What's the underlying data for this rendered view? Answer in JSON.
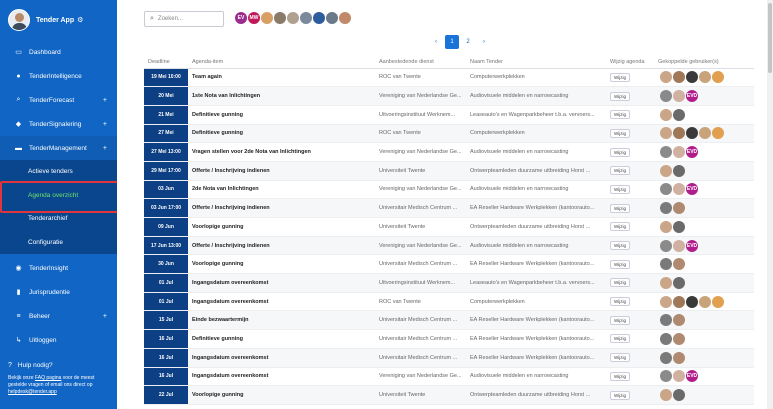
{
  "app": {
    "title": "Tender App"
  },
  "sidebar": {
    "items": [
      {
        "label": "Dashboard",
        "icon": "monitor-icon",
        "glyph": "▭",
        "plus": ""
      },
      {
        "label": "TenderIntelligence",
        "icon": "bulb-icon",
        "glyph": "●",
        "plus": ""
      },
      {
        "label": "TenderForecast",
        "icon": "search-icon",
        "glyph": "⌕",
        "plus": "+"
      },
      {
        "label": "TenderSignalering",
        "icon": "bell-icon",
        "glyph": "◆",
        "plus": "+"
      },
      {
        "label": "TenderManagement",
        "icon": "folder-icon",
        "glyph": "▬",
        "plus": "+"
      }
    ],
    "sub_items": [
      "Actieve tenders",
      "Agenda overzicht",
      "Tenderarchief",
      "Configuratie"
    ],
    "items2": [
      {
        "label": "TenderInsight",
        "icon": "eye-icon",
        "glyph": "◉",
        "plus": ""
      },
      {
        "label": "Jurisprudentie",
        "icon": "book-icon",
        "glyph": "▮",
        "plus": ""
      },
      {
        "label": "Beheer",
        "icon": "sliders-icon",
        "glyph": "≡",
        "plus": "+"
      },
      {
        "label": "Uitloggen",
        "icon": "logout-icon",
        "glyph": "↳",
        "plus": ""
      }
    ],
    "help": {
      "title": "Hulp nodig?",
      "text1": "Bekijk onze",
      "faq": "FAQ pagina",
      "text2": "voor de meest gestelde vragen of email ons direct op",
      "email": "helpdesk@tender.app"
    }
  },
  "search": {
    "placeholder": "Zoeken..."
  },
  "filter_users": [
    {
      "initials": "EV",
      "color": "#9b2d8e"
    },
    {
      "initials": "MW",
      "color": "#c2185b"
    },
    {
      "initials": "",
      "color": "#d9a066"
    },
    {
      "initials": "",
      "color": "#8a7a6a"
    },
    {
      "initials": "",
      "color": "#b0a090"
    },
    {
      "initials": "",
      "color": "#7a8a9a"
    },
    {
      "initials": "",
      "color": "#2e5d9e"
    },
    {
      "initials": "",
      "color": "#6a7a8a"
    },
    {
      "initials": "",
      "color": "#c08a6a"
    }
  ],
  "pagination": {
    "prev": "‹",
    "pages": [
      "1",
      "2"
    ],
    "next": "›"
  },
  "table": {
    "headers": [
      "Deadline",
      "Agenda-item",
      "Aanbestedende dienst",
      "Naam Tender",
      "Wijzig agenda",
      "Gekoppelde gebruiker(s)"
    ],
    "edit_label": "Wijzig",
    "rows": [
      {
        "deadline": "19 Mei 10:00",
        "item": "Team again",
        "dienst": "ROC van Twente",
        "tender": "Computerwerkplekken",
        "users": [
          "#caa588",
          "#a07858",
          "#3a3a3a",
          "#c9a37a",
          "#e0a050"
        ]
      },
      {
        "deadline": "20 Mei",
        "item": "1ste Nota van Inlichtingen",
        "dienst": "Vereniging van Nederlandse Ge...",
        "tender": "Audiovisuele middelen en narrowcasting",
        "users": [
          "#8a8a8a",
          "#d0b0a0",
          "EVD"
        ]
      },
      {
        "deadline": "21 Mei",
        "item": "Definitieve gunning",
        "dienst": "Uitvoeringsinstituut Werknem...",
        "tender": "Leaseauto's en Wagenparkbeheer t.b.a. vervoers...",
        "users": [
          "#caa588",
          "#6a6a6a"
        ]
      },
      {
        "deadline": "27 Mei",
        "item": "Definitieve gunning",
        "dienst": "ROC van Twente",
        "tender": "Computerwerkplekken",
        "users": [
          "#caa588",
          "#a07858",
          "#3a3a3a",
          "#c9a37a",
          "#e0a050"
        ]
      },
      {
        "deadline": "27 Mei 13:00",
        "item": "Vragen stellen voor 2de Nota van Inlichtingen",
        "dienst": "Vereniging van Nederlandse Ge...",
        "tender": "Audiovisuele middelen en narrowcasting",
        "users": [
          "#8a8a8a",
          "#d0b0a0",
          "EVD"
        ]
      },
      {
        "deadline": "29 Mei 17:00",
        "item": "Offerte / Inschrijving indienen",
        "dienst": "Universiteit Twente",
        "tender": "Ontwerpteamleden duurzame uitbreiding Horst ...",
        "users": [
          "#caa588",
          "#6a6a6a"
        ]
      },
      {
        "deadline": "03 Jun",
        "item": "2de Nota van Inlichtingen",
        "dienst": "Vereniging van Nederlandse Ge...",
        "tender": "Audiovisuele middelen en narrowcasting",
        "users": [
          "#8a8a8a",
          "#d0b0a0",
          "EVD"
        ]
      },
      {
        "deadline": "03 Jun 17:00",
        "item": "Offerte / Inschrijving indienen",
        "dienst": "Universitair Medisch Centrum ...",
        "tender": "EA Reseller Hardware Werkplekken (kantoorauto...",
        "users": [
          "#7a7a7a",
          "#b08a70"
        ]
      },
      {
        "deadline": "09 Jun",
        "item": "Voorlopige gunning",
        "dienst": "Universiteit Twente",
        "tender": "Ontwerpteamleden duurzame uitbreiding Horst ...",
        "users": [
          "#caa588",
          "#6a6a6a"
        ]
      },
      {
        "deadline": "17 Jun 13:00",
        "item": "Offerte / Inschrijving indienen",
        "dienst": "Vereniging van Nederlandse Ge...",
        "tender": "Audiovisuele middelen en narrowcasting",
        "users": [
          "#8a8a8a",
          "#d0b0a0",
          "EVD"
        ]
      },
      {
        "deadline": "30 Jun",
        "item": "Voorlopige gunning",
        "dienst": "Universitair Medisch Centrum ...",
        "tender": "EA Reseller Hardware Werkplekken (kantoorauto...",
        "users": [
          "#7a7a7a",
          "#b08a70"
        ]
      },
      {
        "deadline": "01 Jul",
        "item": "Ingangsdatum overeenkomst",
        "dienst": "Uitvoeringsinstituut Werknem...",
        "tender": "Leaseauto's en Wagenparkbeheer t.b.a. vervoers...",
        "users": [
          "#caa588",
          "#6a6a6a"
        ]
      },
      {
        "deadline": "01 Jul",
        "item": "Ingangsdatum overeenkomst",
        "dienst": "ROC van Twente",
        "tender": "Computerwerkplekken",
        "users": [
          "#caa588",
          "#a07858",
          "#3a3a3a",
          "#c9a37a",
          "#e0a050"
        ]
      },
      {
        "deadline": "15 Jul",
        "item": "Einde bezwaartermijn",
        "dienst": "Universitair Medisch Centrum ...",
        "tender": "EA Reseller Hardware Werkplekken (kantoorauto...",
        "users": [
          "#7a7a7a",
          "#b08a70"
        ]
      },
      {
        "deadline": "16 Jul",
        "item": "Definitieve gunning",
        "dienst": "Universitair Medisch Centrum ...",
        "tender": "EA Reseller Hardware Werkplekken (kantoorauto...",
        "users": [
          "#7a7a7a",
          "#b08a70"
        ]
      },
      {
        "deadline": "16 Jul",
        "item": "Ingangsdatum overeenkomst",
        "dienst": "Universitair Medisch Centrum ...",
        "tender": "EA Reseller Hardware Werkplekken (kantoorauto...",
        "users": [
          "#7a7a7a",
          "#b08a70"
        ]
      },
      {
        "deadline": "16 Jul",
        "item": "Ingangsdatum overeenkomst",
        "dienst": "Vereniging van Nederlandse Ge...",
        "tender": "Audiovisuele middelen en narrowcasting",
        "users": [
          "#8a8a8a",
          "#d0b0a0",
          "EVD"
        ]
      },
      {
        "deadline": "22 Jul",
        "item": "Voorlopige gunning",
        "dienst": "Universiteit Twente",
        "tender": "Ontwerpteamleden duurzame uitbreiding Horst ...",
        "users": [
          "#caa588",
          "#6a6a6a"
        ]
      }
    ]
  },
  "colors": {
    "sidebar": "#1165c4",
    "deadline_bg": "#0d3f84",
    "active_sub": "#6fe26b",
    "highlight": "#e0353c",
    "evd": "#b01e8c"
  }
}
